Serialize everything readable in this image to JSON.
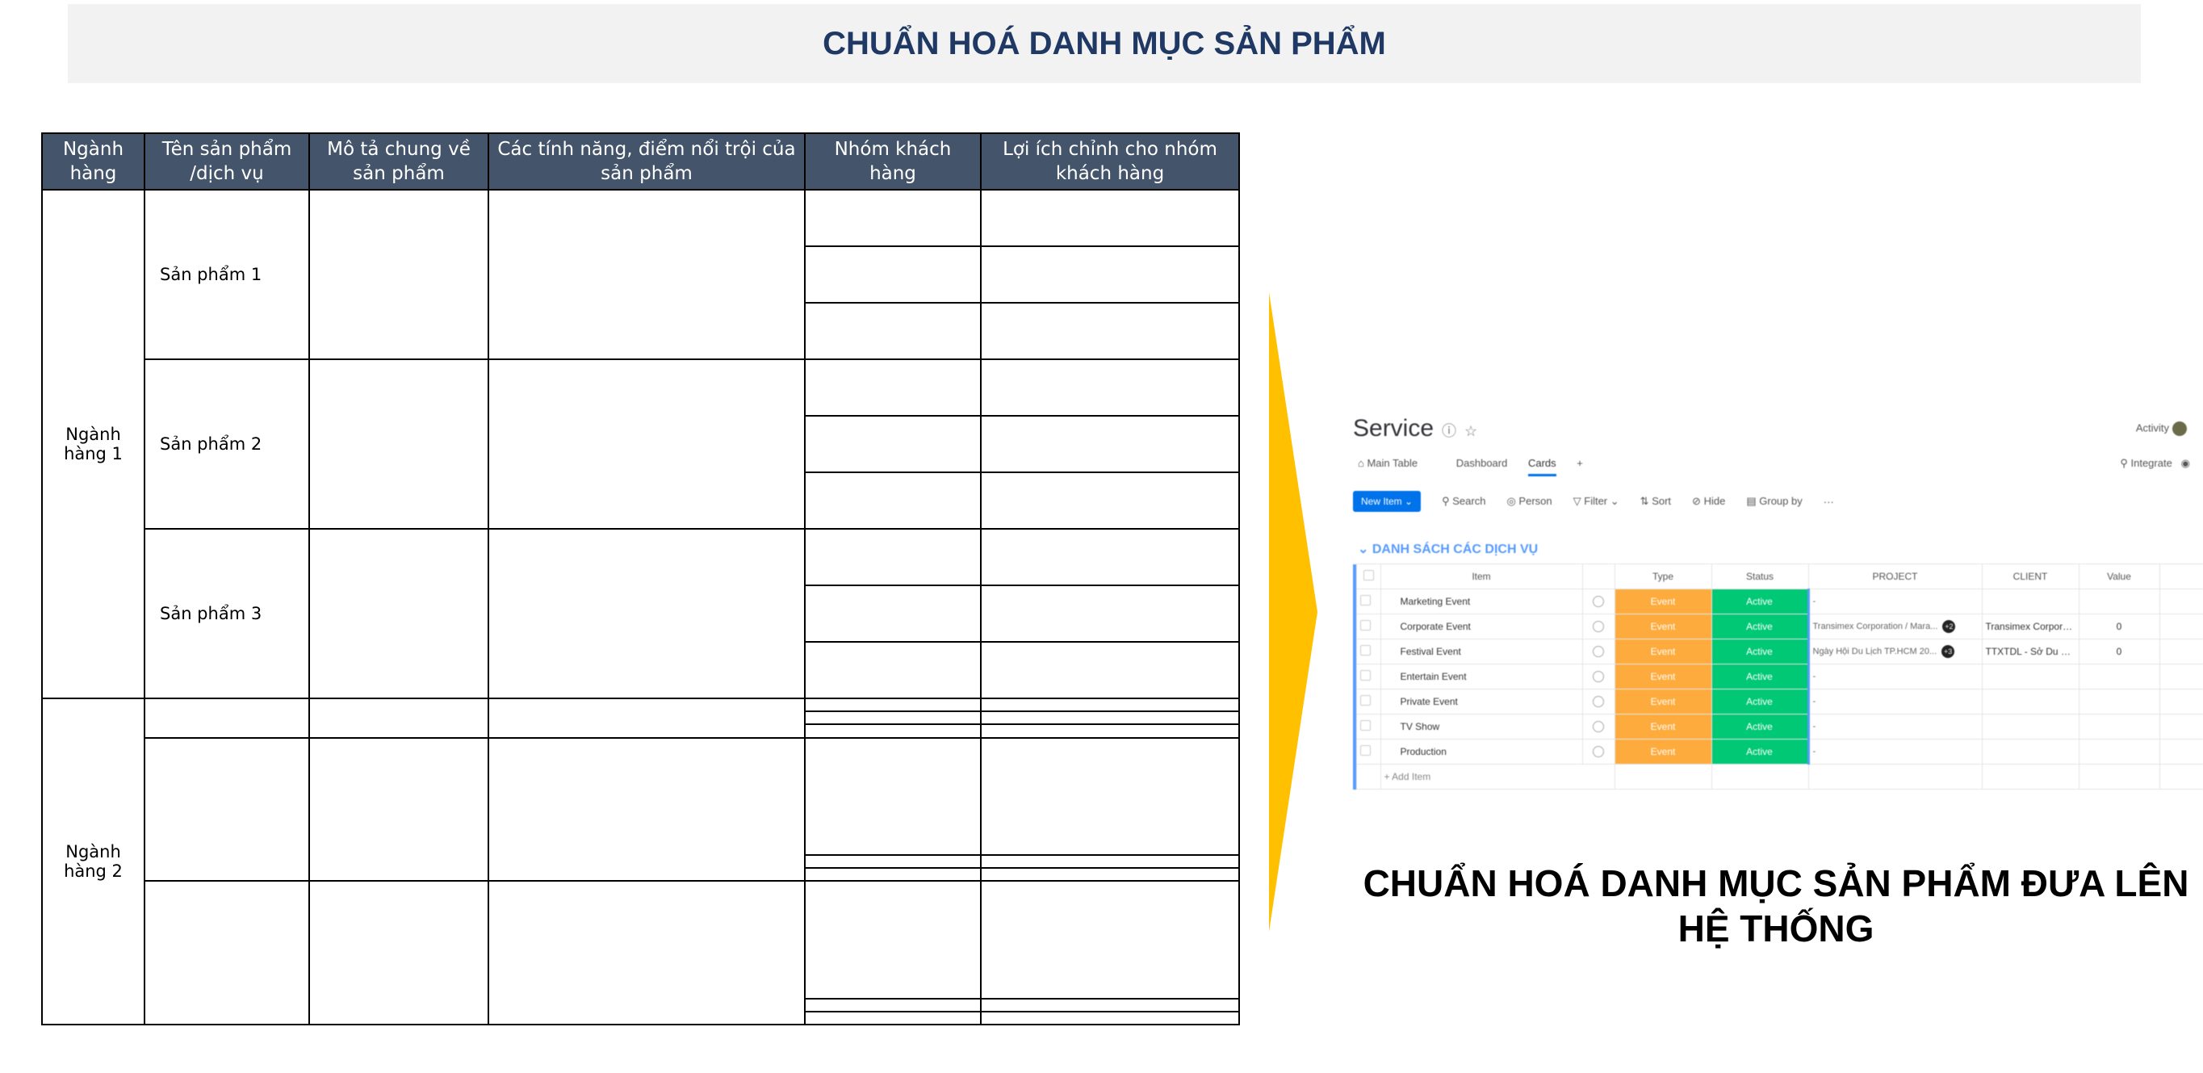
{
  "header": {
    "title": "CHUẨN HOÁ DANH MỤC SẢN PHẨM"
  },
  "matrix": {
    "headers": [
      "Ngành hàng",
      "Tên sản phẩm /dịch vụ",
      "Mô tả chung về sản phẩm",
      "Các tính năng, điểm nổi trội của sản phẩm",
      "Nhóm khách hàng",
      "Lợi ích chỉnh cho nhóm khách hàng"
    ],
    "categories": [
      "Ngành hàng 1",
      "Ngành hàng 2"
    ],
    "products": [
      "Sản phẩm 1",
      "Sản phẩm 2",
      "Sản phẩm 3"
    ]
  },
  "app": {
    "title": "Service",
    "activity_label": "Activity",
    "tabs": [
      "Main Table",
      "Dashboard",
      "Cards",
      "+"
    ],
    "integrate_label": "Integrate",
    "new_item_label": "New Item",
    "toolbar": [
      "Search",
      "Person",
      "Filter",
      "Sort",
      "Hide",
      "Group by",
      "···"
    ],
    "group_title": "DANH SÁCH CÁC DỊCH VỤ",
    "columns": [
      "Item",
      "Type",
      "Status",
      "PROJECT",
      "CLIENT",
      "Value"
    ],
    "rows": [
      {
        "item": "Marketing Event",
        "type": "Event",
        "status": "Active",
        "project": "-",
        "client": "",
        "value": ""
      },
      {
        "item": "Corporate Event",
        "type": "Event",
        "status": "Active",
        "project": "Transimex Corporation / Mara...",
        "badge": "+2",
        "client": "Transimex Corporati...",
        "value": "0"
      },
      {
        "item": "Festival Event",
        "type": "Event",
        "status": "Active",
        "project": "Ngày Hội Du Lịch TP.HCM 20...",
        "badge": "+3",
        "client": "TTXTDL - Sở Du Lịch ...",
        "value": "0"
      },
      {
        "item": "Entertain Event",
        "type": "Event",
        "status": "Active",
        "project": "-",
        "client": "",
        "value": ""
      },
      {
        "item": "Private Event",
        "type": "Event",
        "status": "Active",
        "project": "-",
        "client": "",
        "value": ""
      },
      {
        "item": "TV Show",
        "type": "Event",
        "status": "Active",
        "project": "-",
        "client": "",
        "value": ""
      },
      {
        "item": "Production",
        "type": "Event",
        "status": "Active",
        "project": "-",
        "client": "",
        "value": ""
      }
    ],
    "add_item_label": "+ Add Item",
    "colors": {
      "type": "#fdab3d",
      "status": "#00c875",
      "accent": "#0073ea",
      "group": "#579bfc"
    }
  },
  "caption": {
    "line1": "CHUẨN HOÁ DANH MỤC SẢN PHẨM ĐƯA LÊN",
    "line2": "HỆ THỐNG"
  },
  "arrow_color": "#ffc000"
}
